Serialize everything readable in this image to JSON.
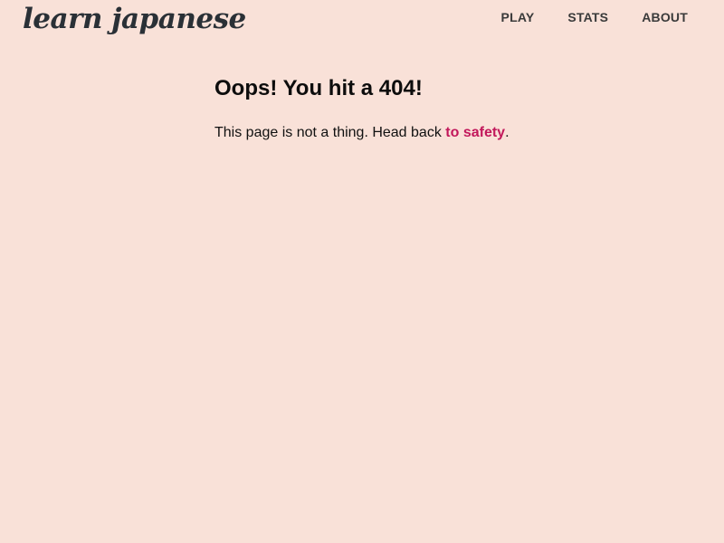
{
  "brand": {
    "logo_text": "learn japanese"
  },
  "nav": {
    "items": [
      {
        "label": "PLAY"
      },
      {
        "label": "STATS"
      },
      {
        "label": "ABOUT"
      }
    ]
  },
  "main": {
    "title": "Oops! You hit a 404!",
    "message_before": "This page is not a thing. Head back ",
    "link_text": "to safety",
    "message_after": "."
  },
  "colors": {
    "background": "#f9e1d8",
    "link_accent": "#c2185b",
    "nav_text": "#3a3a3a",
    "logo": "#2a3036"
  }
}
